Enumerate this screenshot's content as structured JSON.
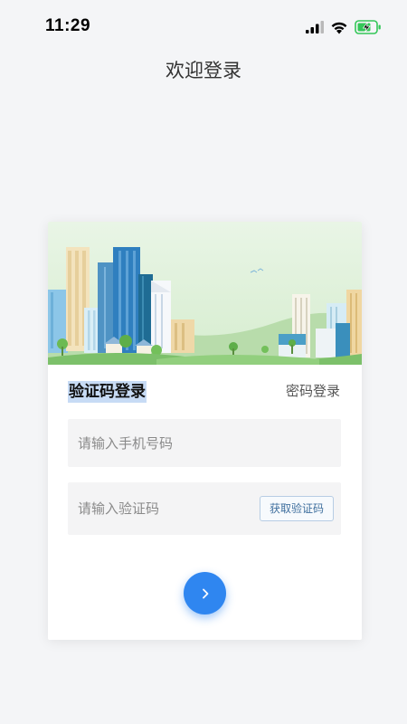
{
  "status_bar": {
    "time": "11:29",
    "icons": [
      "signal-icon",
      "wifi-icon",
      "battery-charging-icon"
    ],
    "battery_color": "#34c759"
  },
  "page": {
    "title": "欢迎登录"
  },
  "login_card": {
    "tabs": {
      "sms_login": "验证码登录",
      "password_login": "密码登录"
    },
    "phone_field": {
      "placeholder": "请输入手机号码",
      "value": ""
    },
    "code_field": {
      "placeholder": "请输入验证码",
      "value": ""
    },
    "get_code_button": "获取验证码",
    "submit_icon": "chevron-right-icon",
    "accent_color": "#2f86f0"
  }
}
